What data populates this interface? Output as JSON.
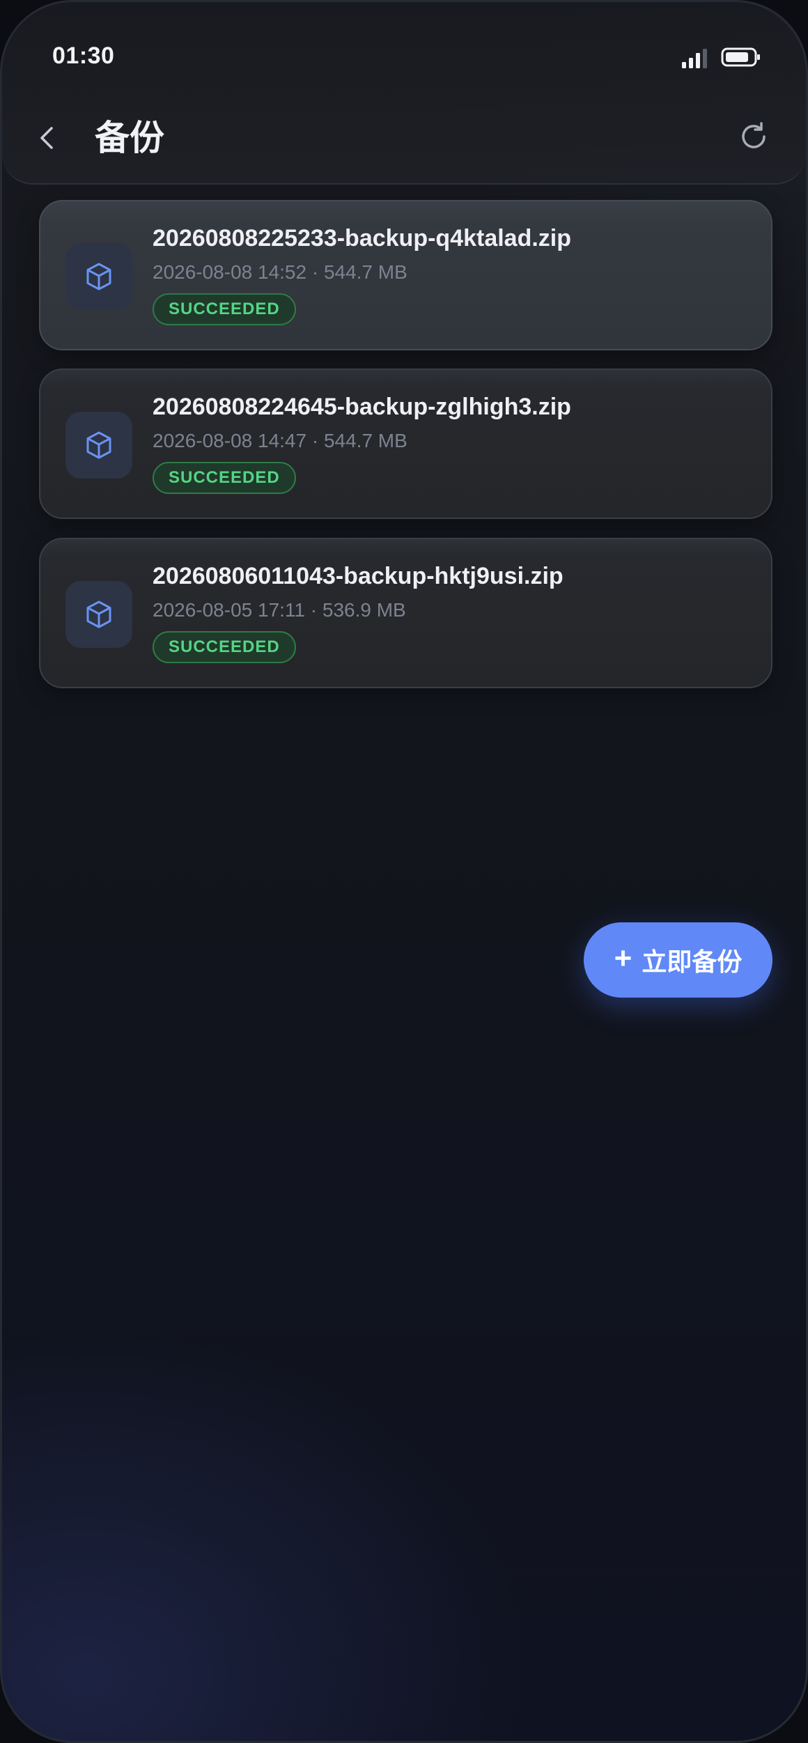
{
  "status_bar": {
    "time": "01:30",
    "signal_icon": "signal-bars-icon",
    "battery_icon": "battery-icon"
  },
  "header": {
    "title": "备份",
    "back_icon": "chevron-left-icon",
    "refresh_icon": "refresh-icon"
  },
  "backups": [
    {
      "name": "20260808225233-backup-q4ktalad.zip",
      "meta": "2026-08-08 14:52 · 544.7 MB",
      "status": "SUCCEEDED",
      "icon": "package-box-icon"
    },
    {
      "name": "20260808224645-backup-zglhigh3.zip",
      "meta": "2026-08-08 14:47 · 544.7 MB",
      "status": "SUCCEEDED",
      "icon": "package-box-icon"
    },
    {
      "name": "20260806011043-backup-hktj9usi.zip",
      "meta": "2026-08-05 17:11 · 536.9 MB",
      "status": "SUCCEEDED",
      "icon": "package-box-icon"
    }
  ],
  "fab": {
    "plus": "+",
    "label": "立即备份"
  },
  "colors": {
    "accent": "#6088f6",
    "success_text": "#55d585",
    "success_border": "#2f7a48",
    "background": "#14171d"
  }
}
